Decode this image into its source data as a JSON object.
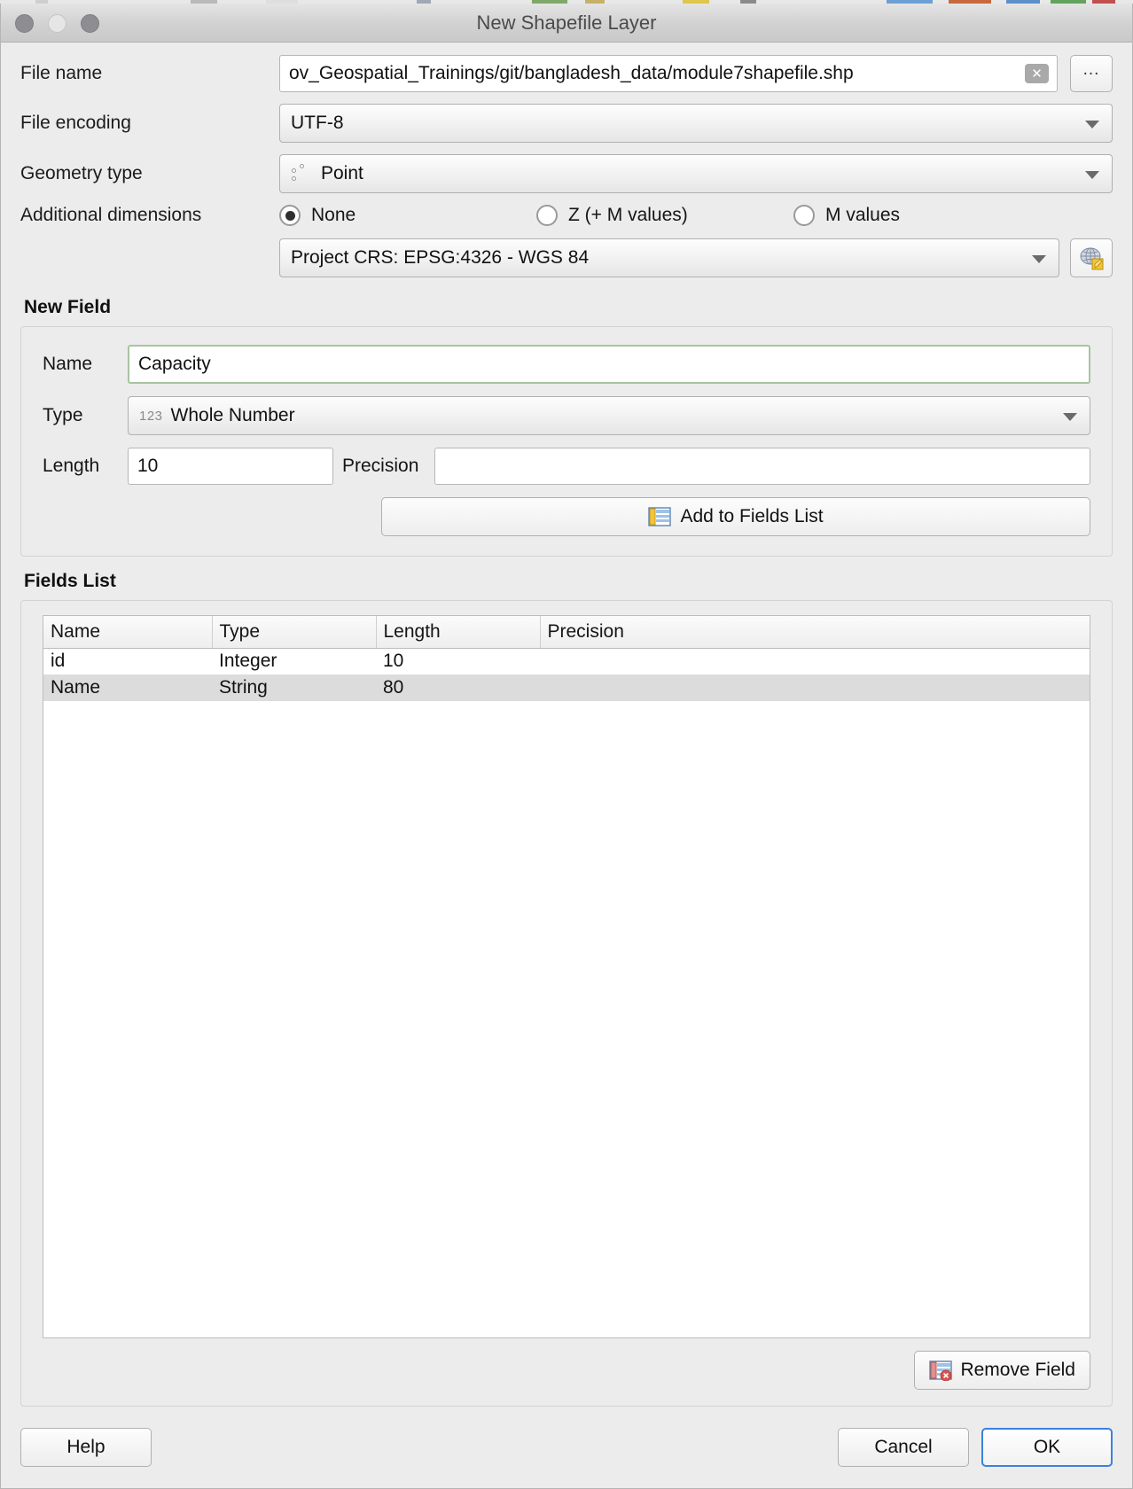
{
  "window": {
    "title": "New Shapefile Layer",
    "traffic_lights": [
      "close-button",
      "minimize-button",
      "zoom-button"
    ]
  },
  "form": {
    "file_name": {
      "label": "File name",
      "value": "ov_Geospatial_Trainings/git/bangladesh_data/module7shapefile.shp",
      "clear_icon": "clear-x-icon",
      "browse_label": "..."
    },
    "file_encoding": {
      "label": "File encoding",
      "value": "UTF-8"
    },
    "geometry_type": {
      "label": "Geometry type",
      "value": "Point",
      "icon": "point-geometry-icon"
    },
    "additional_dimensions": {
      "label": "Additional dimensions",
      "options": [
        {
          "label": "None",
          "selected": true
        },
        {
          "label": "Z (+ M values)",
          "selected": false
        },
        {
          "label": "M values",
          "selected": false
        }
      ]
    },
    "crs": {
      "value": "Project CRS: EPSG:4326 - WGS 84",
      "select_button_icon": "globe-crs-icon"
    }
  },
  "new_field": {
    "title": "New Field",
    "name": {
      "label": "Name",
      "value": "Capacity"
    },
    "type": {
      "label": "Type",
      "value": "Whole Number",
      "prefix": "123"
    },
    "length": {
      "label": "Length",
      "value": "10"
    },
    "precision": {
      "label": "Precision",
      "value": ""
    },
    "add_button": {
      "label": "Add to Fields List",
      "icon": "add-field-icon"
    }
  },
  "fields_list": {
    "title": "Fields List",
    "columns": [
      "Name",
      "Type",
      "Length",
      "Precision"
    ],
    "rows": [
      {
        "name": "id",
        "type": "Integer",
        "length": "10",
        "precision": "",
        "selected": false
      },
      {
        "name": "Name",
        "type": "String",
        "length": "80",
        "precision": "",
        "selected": true
      }
    ],
    "remove_button": {
      "label": "Remove Field",
      "icon": "remove-field-icon"
    }
  },
  "footer": {
    "help_label": "Help",
    "cancel_label": "Cancel",
    "ok_label": "OK"
  },
  "colors": {
    "dialog_bg": "#ececec",
    "focus_blue": "#3b82dd",
    "valid_green": "#a8c3a0",
    "selection_gray": "#dcdcdc"
  }
}
